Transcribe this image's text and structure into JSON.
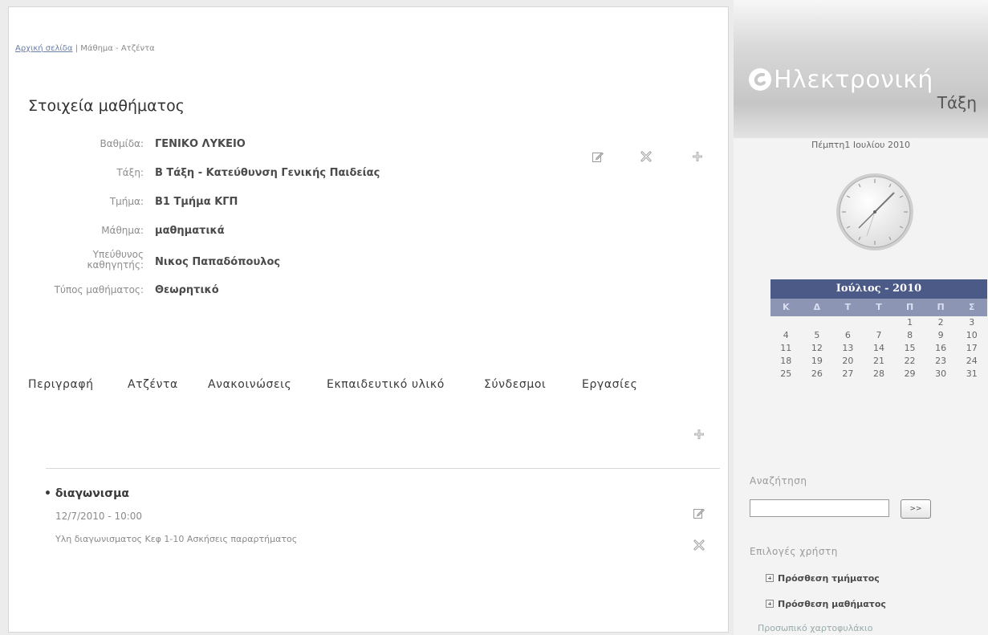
{
  "breadcrumb": {
    "home": "Αρχική σελίδα",
    "sep": " | ",
    "current": "Μάθημα - Ατζέντα"
  },
  "page_title": "Στοιχεία μαθήματος",
  "details": [
    {
      "label": "Βαθμίδα:",
      "value": "ΓΕΝΙΚΟ ΛΥΚΕΙΟ"
    },
    {
      "label": "Τάξη:",
      "value": "Β Τάξη - Κατεύθυνση Γενικής Παιδείας"
    },
    {
      "label": "Τμήμα:",
      "value": "Β1 Τμήμα ΚΓΠ"
    },
    {
      "label": "Μάθημα:",
      "value": "μαθηματικά"
    },
    {
      "label": "Υπεύθυνος καθηγητής:",
      "value": "Νικος Παπαδόπουλος"
    },
    {
      "label": "Τύπος μαθήματος:",
      "value": "Θεωρητικό"
    }
  ],
  "tabs": [
    "Περιγραφή",
    "Ατζέντα",
    "Ανακοινώσεις",
    "Εκπαιδευτικό υλικό",
    "Σύνδεσμοι",
    "Εργασίες"
  ],
  "agenda_item": {
    "title": "• διαγωνισμα",
    "date": "12/7/2010 - 10:00",
    "description": "Υλη διαγωνισματος Κεφ 1-10 Ασκήσεις παραρτήματος"
  },
  "sidebar": {
    "logo": {
      "word1": "Ηλεκτρονική",
      "word2": "Τάξη"
    },
    "date_line": "Πέμπτη1 Ιουλίου 2010",
    "calendar": {
      "month_label": "Ιούλιος - 2010",
      "weekdays": [
        "Κ",
        "Δ",
        "Τ",
        "Τ",
        "Π",
        "Π",
        "Σ"
      ],
      "cells": [
        "",
        "",
        "",
        "",
        "1",
        "2",
        "3",
        "4",
        "5",
        "6",
        "7",
        "8",
        "9",
        "10",
        "11",
        "12",
        "13",
        "14",
        "15",
        "16",
        "17",
        "18",
        "19",
        "20",
        "21",
        "22",
        "23",
        "24",
        "25",
        "26",
        "27",
        "28",
        "29",
        "30",
        "31"
      ]
    },
    "search": {
      "label": "Αναζήτηση",
      "button": ">>",
      "value": ""
    },
    "user_options": {
      "label": "Επιλογές χρήστη",
      "items": [
        "Πρόσθεση τμήματος",
        "Πρόσθεση μαθήματος"
      ],
      "cut_item": "Προσωπικό χαρτοφυλάκιο"
    }
  },
  "colors": {
    "calendar_header": "#4b5a87",
    "calendar_days": "#8c95b4",
    "link": "#6b7fa6"
  },
  "icons": [
    "edit-icon",
    "delete-icon",
    "add-icon",
    "clock-icon",
    "logo-icon"
  ]
}
